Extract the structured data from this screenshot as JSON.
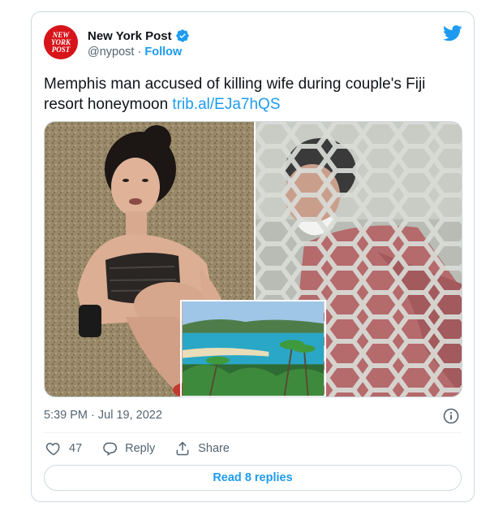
{
  "account": {
    "name": "New York Post",
    "handle": "@nypost",
    "separator": "·",
    "follow_label": "Follow",
    "avatar_lines": [
      "NEW",
      "YORK",
      "POST"
    ]
  },
  "tweet": {
    "text": "Memphis man accused of killing wife during couple's Fiji resort honeymoon ",
    "link": "trib.al/EJa7hQS",
    "timestamp": "5:39 PM · Jul 19, 2022"
  },
  "actions": {
    "likes_count": "47",
    "reply_label": "Reply",
    "share_label": "Share"
  },
  "read_replies_label": "Read 8 replies",
  "colors": {
    "accent": "#1d9bf0",
    "brand_red": "#d7141a",
    "text": "#0f1419",
    "muted": "#536471"
  },
  "icons": [
    "verified-badge-icon",
    "twitter-bird-icon",
    "info-icon",
    "heart-icon",
    "reply-icon",
    "share-icon"
  ]
}
